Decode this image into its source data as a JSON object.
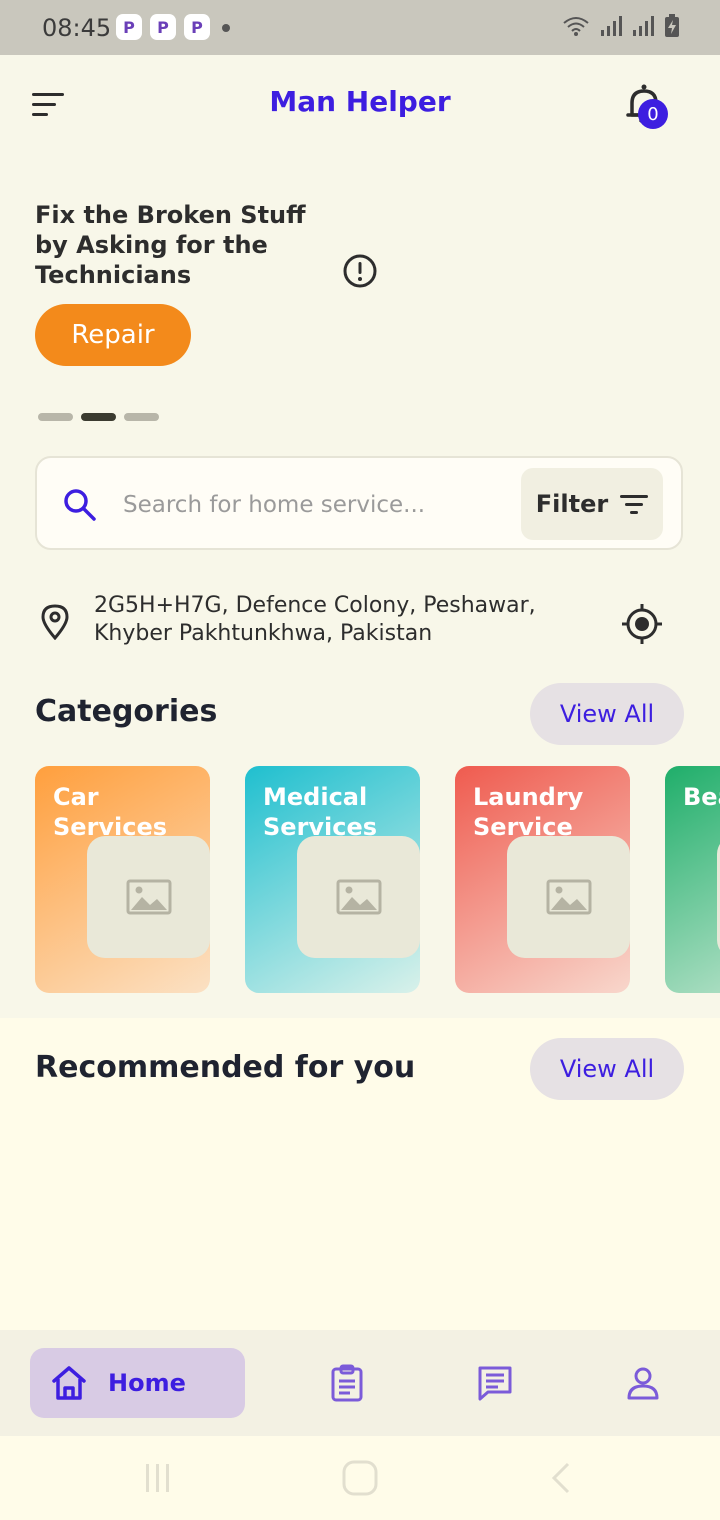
{
  "status_bar": {
    "time": "08:45",
    "app_icons": [
      "P",
      "P",
      "P"
    ]
  },
  "app_bar": {
    "title": "Man Helper",
    "notification_count": "0"
  },
  "banner": {
    "text": "Fix the Broken Stuff by Asking for the Technicians",
    "button_label": "Repair",
    "carousel_pages": 3,
    "carousel_active_index": 1
  },
  "search": {
    "placeholder": "Search for home service...",
    "filter_label": "Filter"
  },
  "location": {
    "line1": "2G5H+H7G, Defence Colony, Peshawar,",
    "line2": "Khyber Pakhtunkhwa, Pakistan"
  },
  "categories": {
    "title": "Categories",
    "view_all_label": "View All",
    "items": [
      {
        "label": "Car Services",
        "color_start": "#ff9f3d",
        "color_end": "#fbe1c4"
      },
      {
        "label": "Medical Services",
        "color_start": "#1fbfcf",
        "color_end": "#d9f1ea"
      },
      {
        "label": "Laundry Service",
        "color_start": "#ef5b4f",
        "color_end": "#f8d7cc"
      },
      {
        "label": "Bea Hai",
        "color_start": "#1fae6a",
        "color_end": "#cde9d7"
      }
    ]
  },
  "recommended": {
    "title": "Recommended for you",
    "view_all_label": "View All"
  },
  "bottom_nav": {
    "home_label": "Home",
    "items": [
      "home-icon",
      "orders-icon",
      "chat-icon",
      "profile-icon"
    ]
  },
  "colors": {
    "accent": "#3d1ee0",
    "orange": "#f38a1b",
    "background": "#f8f7e9"
  }
}
